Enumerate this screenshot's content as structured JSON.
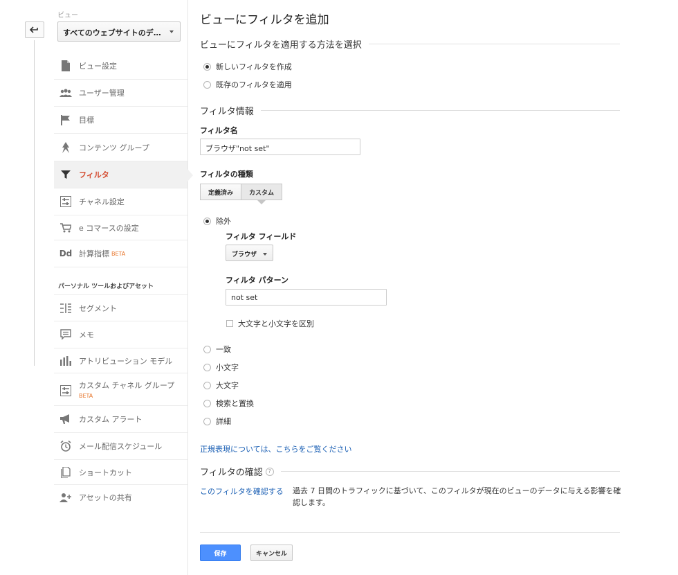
{
  "sidebar": {
    "view_label": "ビュー",
    "view_select_value": "すべてのウェブサイトのデ…",
    "items": [
      {
        "label": "ビュー設定",
        "icon": "document-icon"
      },
      {
        "label": "ユーザー管理",
        "icon": "users-icon"
      },
      {
        "label": "目標",
        "icon": "flag-icon"
      },
      {
        "label": "コンテンツ グループ",
        "icon": "content-group-icon"
      },
      {
        "label": "フィルタ",
        "icon": "filter-icon",
        "active": true
      },
      {
        "label": "チャネル設定",
        "icon": "channel-icon"
      },
      {
        "label": "e コマースの設定",
        "icon": "cart-icon"
      },
      {
        "label": "計算指標",
        "icon": "dd-icon",
        "badge": "BETA"
      }
    ],
    "section_title": "パーソナル ツールおよびアセット",
    "personal_items": [
      {
        "label": "セグメント",
        "icon": "segment-icon"
      },
      {
        "label": "メモ",
        "icon": "memo-icon"
      },
      {
        "label": "アトリビューション モデル",
        "icon": "bar-chart-icon"
      },
      {
        "label": "カスタム チャネル グループ",
        "icon": "channel-icon",
        "badge": "BETA"
      },
      {
        "label": "カスタム アラート",
        "icon": "megaphone-icon"
      },
      {
        "label": "メール配信スケジュール",
        "icon": "alarm-clock-icon"
      },
      {
        "label": "ショートカット",
        "icon": "copy-icon"
      },
      {
        "label": "アセットの共有",
        "icon": "add-user-icon"
      }
    ],
    "dd_glyph": "Dd"
  },
  "main": {
    "title": "ビューにフィルタを追加",
    "apply_section": "ビューにフィルタを適用する方法を選択",
    "apply_options": [
      {
        "label": "新しいフィルタを作成",
        "selected": true
      },
      {
        "label": "既存のフィルタを適用",
        "selected": false
      }
    ],
    "info_section": "フィルタ情報",
    "name_label": "フィルタ名",
    "name_value": "ブラウザ\"not set\"",
    "type_label": "フィルタの種類",
    "tabs": [
      {
        "label": "定義済み",
        "active": false
      },
      {
        "label": "カスタム",
        "active": true
      }
    ],
    "custom_options": [
      {
        "label": "除外",
        "selected": true
      },
      {
        "label": "一致",
        "selected": false
      },
      {
        "label": "小文字",
        "selected": false
      },
      {
        "label": "大文字",
        "selected": false
      },
      {
        "label": "検索と置換",
        "selected": false
      },
      {
        "label": "詳細",
        "selected": false
      }
    ],
    "field_label": "フィルタ フィールド",
    "field_value": "ブラウザ",
    "pattern_label": "フィルタ パターン",
    "pattern_value": "not set",
    "case_checkbox": "大文字と小文字を区別",
    "regex_link": "正規表現については、こちらをご覧ください",
    "verify_section": "フィルタの確認",
    "help_glyph": "?",
    "verify_link": "このフィルタを確認する",
    "verify_desc": "過去 7 日間のトラフィックに基づいて、このフィルタが現在のビューのデータに与える影響を確認します。",
    "save_label": "保存",
    "cancel_label": "キャンセル"
  },
  "colors": {
    "accent_active": "#d44a2e",
    "link": "#1a5fb4",
    "primary_button": "#4d90fe",
    "beta": "#e8762c"
  }
}
